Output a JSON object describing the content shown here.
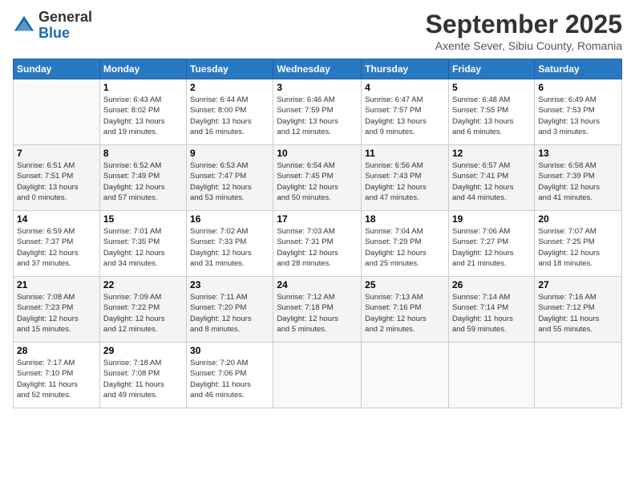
{
  "app": {
    "logo_line1": "General",
    "logo_line2": "Blue"
  },
  "header": {
    "month_year": "September 2025",
    "location": "Axente Sever, Sibiu County, Romania"
  },
  "weekdays": [
    "Sunday",
    "Monday",
    "Tuesday",
    "Wednesday",
    "Thursday",
    "Friday",
    "Saturday"
  ],
  "weeks": [
    [
      {
        "day": "",
        "info": ""
      },
      {
        "day": "1",
        "info": "Sunrise: 6:43 AM\nSunset: 8:02 PM\nDaylight: 13 hours\nand 19 minutes."
      },
      {
        "day": "2",
        "info": "Sunrise: 6:44 AM\nSunset: 8:00 PM\nDaylight: 13 hours\nand 16 minutes."
      },
      {
        "day": "3",
        "info": "Sunrise: 6:46 AM\nSunset: 7:59 PM\nDaylight: 13 hours\nand 12 minutes."
      },
      {
        "day": "4",
        "info": "Sunrise: 6:47 AM\nSunset: 7:57 PM\nDaylight: 13 hours\nand 9 minutes."
      },
      {
        "day": "5",
        "info": "Sunrise: 6:48 AM\nSunset: 7:55 PM\nDaylight: 13 hours\nand 6 minutes."
      },
      {
        "day": "6",
        "info": "Sunrise: 6:49 AM\nSunset: 7:53 PM\nDaylight: 13 hours\nand 3 minutes."
      }
    ],
    [
      {
        "day": "7",
        "info": "Sunrise: 6:51 AM\nSunset: 7:51 PM\nDaylight: 13 hours\nand 0 minutes."
      },
      {
        "day": "8",
        "info": "Sunrise: 6:52 AM\nSunset: 7:49 PM\nDaylight: 12 hours\nand 57 minutes."
      },
      {
        "day": "9",
        "info": "Sunrise: 6:53 AM\nSunset: 7:47 PM\nDaylight: 12 hours\nand 53 minutes."
      },
      {
        "day": "10",
        "info": "Sunrise: 6:54 AM\nSunset: 7:45 PM\nDaylight: 12 hours\nand 50 minutes."
      },
      {
        "day": "11",
        "info": "Sunrise: 6:56 AM\nSunset: 7:43 PM\nDaylight: 12 hours\nand 47 minutes."
      },
      {
        "day": "12",
        "info": "Sunrise: 6:57 AM\nSunset: 7:41 PM\nDaylight: 12 hours\nand 44 minutes."
      },
      {
        "day": "13",
        "info": "Sunrise: 6:58 AM\nSunset: 7:39 PM\nDaylight: 12 hours\nand 41 minutes."
      }
    ],
    [
      {
        "day": "14",
        "info": "Sunrise: 6:59 AM\nSunset: 7:37 PM\nDaylight: 12 hours\nand 37 minutes."
      },
      {
        "day": "15",
        "info": "Sunrise: 7:01 AM\nSunset: 7:35 PM\nDaylight: 12 hours\nand 34 minutes."
      },
      {
        "day": "16",
        "info": "Sunrise: 7:02 AM\nSunset: 7:33 PM\nDaylight: 12 hours\nand 31 minutes."
      },
      {
        "day": "17",
        "info": "Sunrise: 7:03 AM\nSunset: 7:31 PM\nDaylight: 12 hours\nand 28 minutes."
      },
      {
        "day": "18",
        "info": "Sunrise: 7:04 AM\nSunset: 7:29 PM\nDaylight: 12 hours\nand 25 minutes."
      },
      {
        "day": "19",
        "info": "Sunrise: 7:06 AM\nSunset: 7:27 PM\nDaylight: 12 hours\nand 21 minutes."
      },
      {
        "day": "20",
        "info": "Sunrise: 7:07 AM\nSunset: 7:25 PM\nDaylight: 12 hours\nand 18 minutes."
      }
    ],
    [
      {
        "day": "21",
        "info": "Sunrise: 7:08 AM\nSunset: 7:23 PM\nDaylight: 12 hours\nand 15 minutes."
      },
      {
        "day": "22",
        "info": "Sunrise: 7:09 AM\nSunset: 7:22 PM\nDaylight: 12 hours\nand 12 minutes."
      },
      {
        "day": "23",
        "info": "Sunrise: 7:11 AM\nSunset: 7:20 PM\nDaylight: 12 hours\nand 8 minutes."
      },
      {
        "day": "24",
        "info": "Sunrise: 7:12 AM\nSunset: 7:18 PM\nDaylight: 12 hours\nand 5 minutes."
      },
      {
        "day": "25",
        "info": "Sunrise: 7:13 AM\nSunset: 7:16 PM\nDaylight: 12 hours\nand 2 minutes."
      },
      {
        "day": "26",
        "info": "Sunrise: 7:14 AM\nSunset: 7:14 PM\nDaylight: 11 hours\nand 59 minutes."
      },
      {
        "day": "27",
        "info": "Sunrise: 7:16 AM\nSunset: 7:12 PM\nDaylight: 11 hours\nand 55 minutes."
      }
    ],
    [
      {
        "day": "28",
        "info": "Sunrise: 7:17 AM\nSunset: 7:10 PM\nDaylight: 11 hours\nand 52 minutes."
      },
      {
        "day": "29",
        "info": "Sunrise: 7:18 AM\nSunset: 7:08 PM\nDaylight: 11 hours\nand 49 minutes."
      },
      {
        "day": "30",
        "info": "Sunrise: 7:20 AM\nSunset: 7:06 PM\nDaylight: 11 hours\nand 46 minutes."
      },
      {
        "day": "",
        "info": ""
      },
      {
        "day": "",
        "info": ""
      },
      {
        "day": "",
        "info": ""
      },
      {
        "day": "",
        "info": ""
      }
    ]
  ]
}
